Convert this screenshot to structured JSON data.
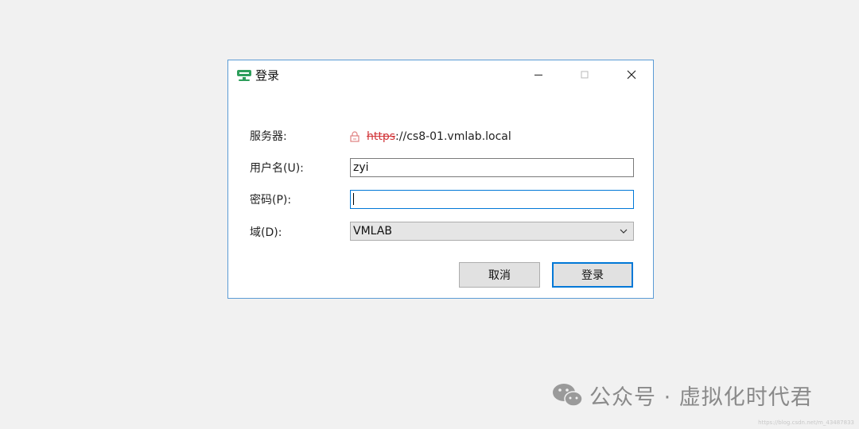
{
  "window": {
    "title": "登录"
  },
  "form": {
    "server_label": "服务器:",
    "server_scheme": "https",
    "server_rest": "://cs8-01.vmlab.local",
    "username_label": "用户名(U):",
    "username_value": "zyi",
    "password_label": "密码(P):",
    "password_value": "",
    "domain_label": "域(D):",
    "domain_value": "VMLAB"
  },
  "buttons": {
    "cancel": "取消",
    "login": "登录"
  },
  "watermark": {
    "text": "公众号 · 虚拟化时代君",
    "small": "https://blog.csdn.net/m_43487833"
  },
  "colors": {
    "accent": "#0078d7",
    "insecure": "#d13438",
    "app_icon": "#2e9e5b"
  }
}
